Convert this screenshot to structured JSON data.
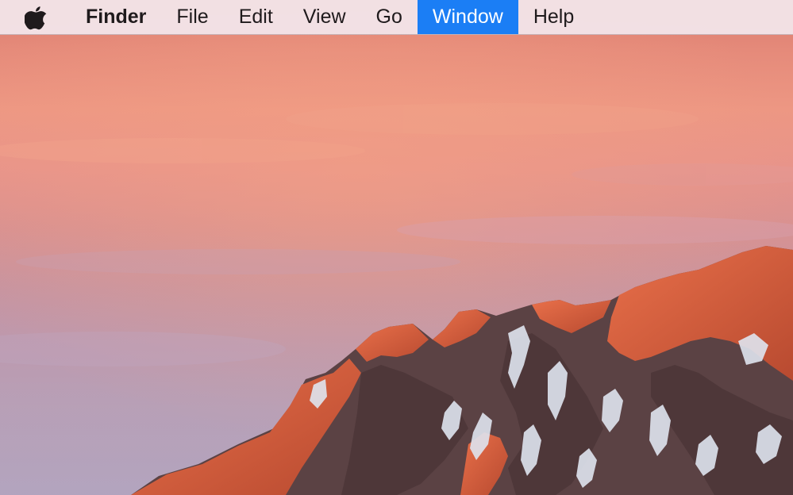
{
  "menubar": {
    "apple_icon": "apple-logo-icon",
    "app_name": "Finder",
    "items": [
      {
        "label": "File",
        "active": false
      },
      {
        "label": "Edit",
        "active": false
      },
      {
        "label": "View",
        "active": false
      },
      {
        "label": "Go",
        "active": false
      },
      {
        "label": "Window",
        "active": true
      },
      {
        "label": "Help",
        "active": false
      }
    ]
  },
  "wallpaper": {
    "description_icon": "mountain-sunset-wallpaper",
    "colors": {
      "sky_top": "#d9786c",
      "sky_mid": "#ed9783",
      "sky_bottom": "#b2a3bd",
      "rock_lit": "#d8623c",
      "rock_shadow": "#5a3f40",
      "snow": "#dfe3ee"
    }
  },
  "colors": {
    "menubar_bg": "#f2e4e8",
    "menu_highlight": "#1b7ef5",
    "menu_text": "#1f1a1c"
  }
}
